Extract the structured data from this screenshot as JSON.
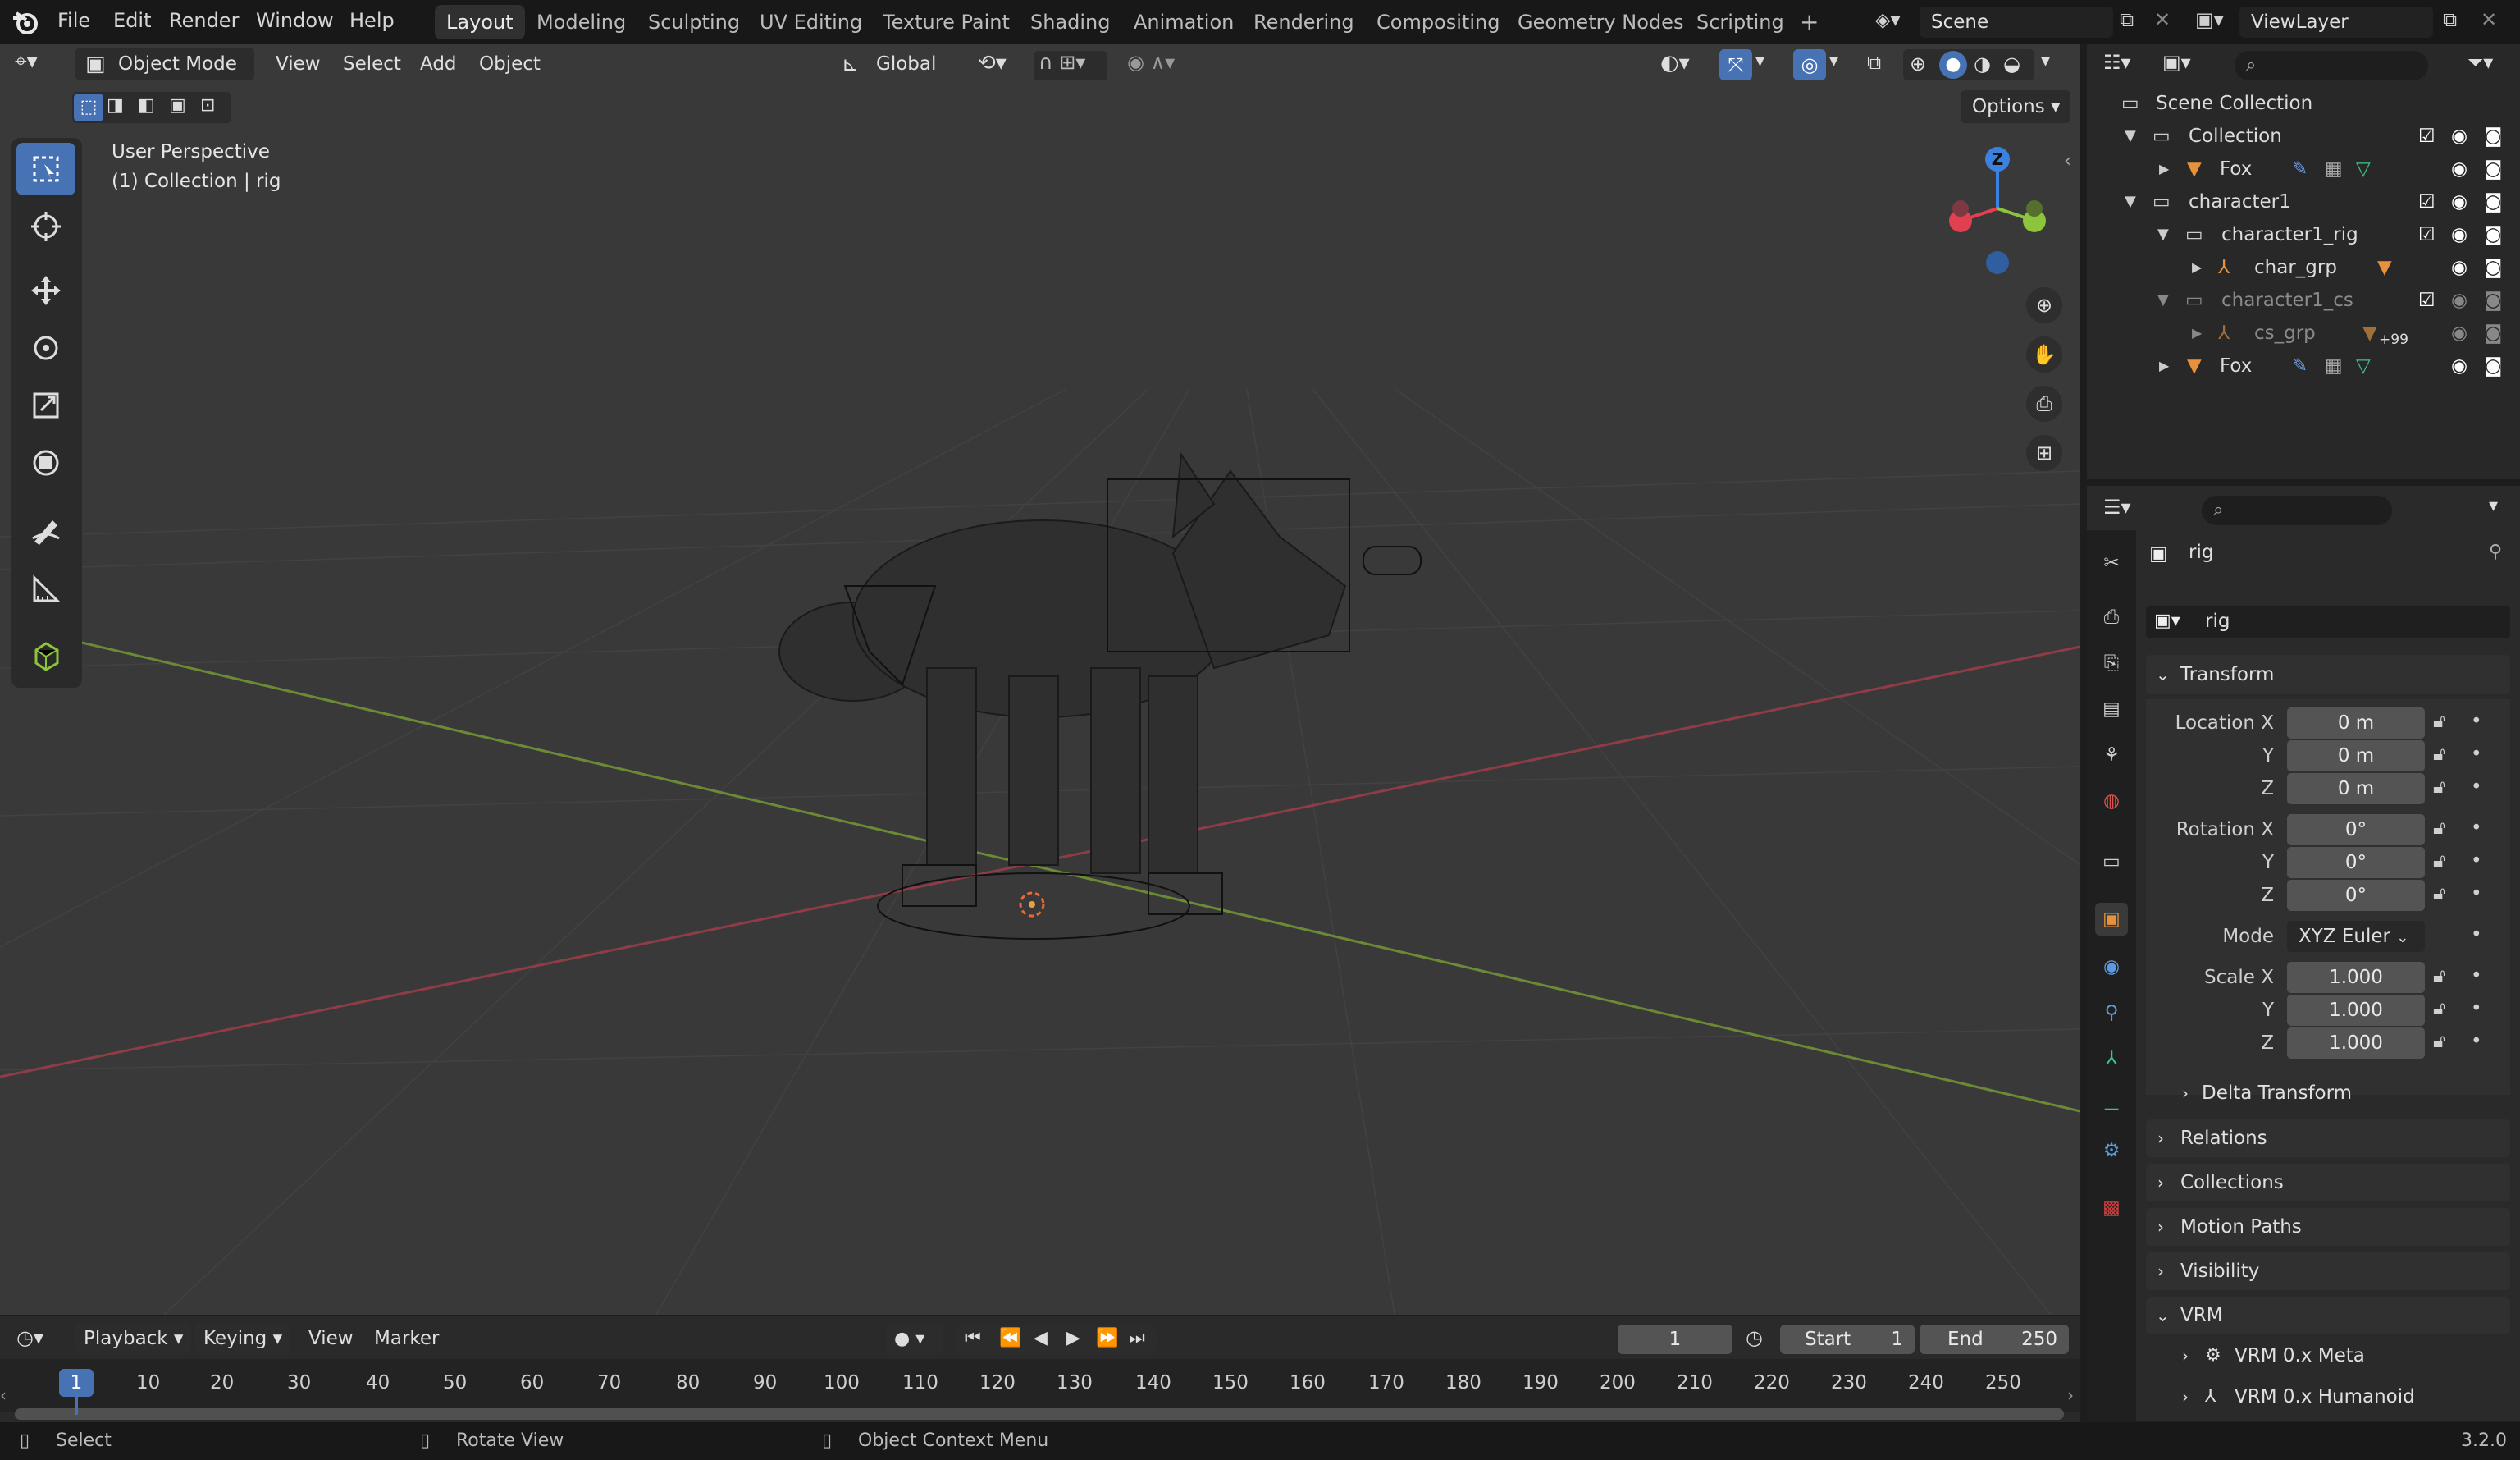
{
  "menu": [
    "File",
    "Edit",
    "Render",
    "Window",
    "Help"
  ],
  "workspaces": [
    "Layout",
    "Modeling",
    "Sculpting",
    "UV Editing",
    "Texture Paint",
    "Shading",
    "Animation",
    "Rendering",
    "Compositing",
    "Geometry Nodes",
    "Scripting"
  ],
  "scene": {
    "label": "Scene",
    "view_layer": "ViewLayer"
  },
  "viewport": {
    "mode": "Object Mode",
    "menus": [
      "View",
      "Select",
      "Add",
      "Object"
    ],
    "orientation": "Global",
    "options": "Options",
    "overlay_title": "User Perspective",
    "overlay_sub": "(1) Collection | rig",
    "gizmo_axis": "Z"
  },
  "outliner": {
    "rows": [
      {
        "label": "Scene Collection"
      },
      {
        "label": "Collection"
      },
      {
        "label": "Fox"
      },
      {
        "label": "character1"
      },
      {
        "label": "character1_rig"
      },
      {
        "label": "char_grp"
      },
      {
        "label": "character1_cs"
      },
      {
        "label": "cs_grp"
      },
      {
        "label": "Fox"
      }
    ],
    "badge": "99"
  },
  "properties": {
    "object_name": "rig",
    "datablock": "rig",
    "transform_title": "Transform",
    "loc_label": "Location X",
    "y": "Y",
    "z": "Z",
    "rot_label": "Rotation X",
    "mode_label": "Mode",
    "mode_value": "XYZ Euler",
    "scale_label": "Scale X",
    "loc": [
      "0 m",
      "0 m",
      "0 m"
    ],
    "rot": [
      "0°",
      "0°",
      "0°"
    ],
    "scale": [
      "1.000",
      "1.000",
      "1.000"
    ],
    "sections": [
      "Delta Transform",
      "Relations",
      "Collections",
      "Motion Paths",
      "Visibility",
      "VRM"
    ],
    "vrm_items": [
      "VRM 0.x Meta",
      "VRM 0.x Humanoid"
    ]
  },
  "timeline": {
    "menus": [
      "Playback",
      "Keying",
      "View",
      "Marker"
    ],
    "current_frame": "1",
    "start_label": "Start",
    "start": "1",
    "end_label": "End",
    "end": "250",
    "ruler": [
      "1",
      "10",
      "20",
      "30",
      "40",
      "50",
      "60",
      "70",
      "80",
      "90",
      "100",
      "110",
      "120",
      "130",
      "140",
      "150",
      "160",
      "170",
      "180",
      "190",
      "200",
      "210",
      "220",
      "230",
      "240",
      "250"
    ]
  },
  "status": {
    "select": "Select",
    "rotate": "Rotate View",
    "context": "Object Context Menu",
    "version": "3.2.0"
  },
  "colors": {
    "accent": "#4772b3",
    "x_axis": "#e0404f",
    "y_axis": "#8cc43b",
    "z_axis": "#3b82e0",
    "bg": "#393939"
  }
}
